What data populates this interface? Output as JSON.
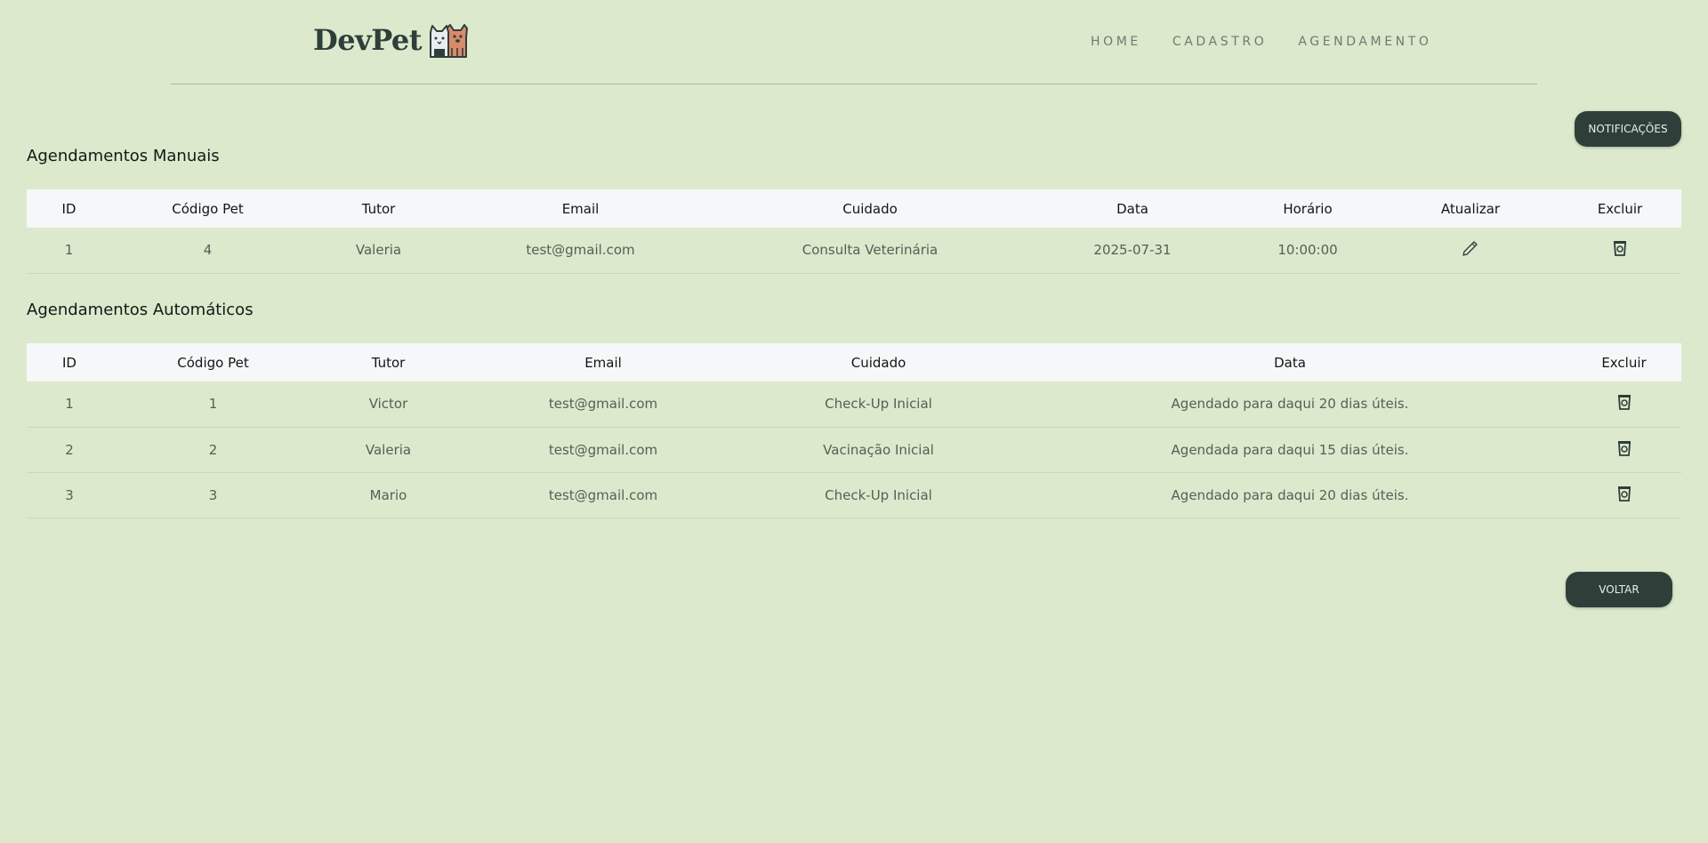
{
  "brand": {
    "name": "DevPet",
    "colors": {
      "background": "#dce9cd",
      "primary_dark": "#2e3f3a",
      "table_header_bg": "#f5f7f8"
    }
  },
  "nav": {
    "items": [
      "HOME",
      "CADASTRO",
      "AGENDAMENTO"
    ]
  },
  "actions": {
    "notifications": "NOTIFICAÇÕES",
    "back": "VOLTAR"
  },
  "manual": {
    "title": "Agendamentos Manuais",
    "columns": [
      "ID",
      "Código Pet",
      "Tutor",
      "Email",
      "Cuidado",
      "Data",
      "Horário",
      "Atualizar",
      "Excluir"
    ],
    "rows": [
      {
        "id": "1",
        "pet": "4",
        "tutor": "Valeria",
        "email": "test@gmail.com",
        "cuidado": "Consulta Veterinária",
        "data": "2025-07-31",
        "horario": "10:00:00",
        "update_icon": "pencil-icon",
        "delete_icon": "trash-icon"
      }
    ]
  },
  "auto": {
    "title": "Agendamentos Automáticos",
    "columns": [
      "ID",
      "Código Pet",
      "Tutor",
      "Email",
      "Cuidado",
      "Data",
      "Excluir"
    ],
    "rows": [
      {
        "id": "1",
        "pet": "1",
        "tutor": "Victor",
        "email": "test@gmail.com",
        "cuidado": "Check-Up Inicial",
        "data": "Agendado para daqui 20 dias úteis.",
        "delete_icon": "trash-icon"
      },
      {
        "id": "2",
        "pet": "2",
        "tutor": "Valeria",
        "email": "test@gmail.com",
        "cuidado": "Vacinação Inicial",
        "data": "Agendada para daqui 15 dias úteis.",
        "delete_icon": "trash-icon"
      },
      {
        "id": "3",
        "pet": "3",
        "tutor": "Mario",
        "email": "test@gmail.com",
        "cuidado": "Check-Up Inicial",
        "data": "Agendado para daqui 20 dias úteis.",
        "delete_icon": "trash-icon"
      }
    ]
  }
}
